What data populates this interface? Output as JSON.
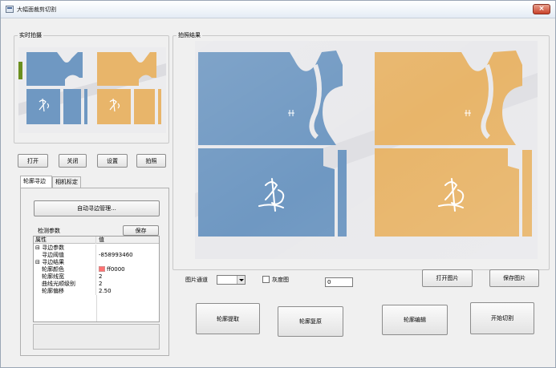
{
  "window": {
    "title": "大幅面裁剪切割",
    "close_glyph": "×"
  },
  "live_group": {
    "legend": "实时拍摄"
  },
  "buttons": {
    "open": "打开",
    "close": "关闭",
    "settings": "设置",
    "capture": "拍照"
  },
  "tabs": [
    {
      "label": "轮廓寻边"
    },
    {
      "label": "相机标定"
    }
  ],
  "auto_seek_button": "自动寻边管理...",
  "detect_params": {
    "label": "检测参数",
    "save": "保存"
  },
  "property_grid": {
    "header": {
      "name": "属性",
      "value": "值"
    },
    "rows": [
      {
        "type": "category",
        "expand": "⊟",
        "name": "寻边参数",
        "value": ""
      },
      {
        "type": "item",
        "name": "寻边阈值",
        "value": "-858993460"
      },
      {
        "type": "category",
        "expand": "⊟",
        "name": "寻边结果",
        "value": ""
      },
      {
        "type": "item",
        "name": "轮廓颜色",
        "value": "ff0000",
        "swatch": "#ff0000"
      },
      {
        "type": "item",
        "name": "轮廓线宽",
        "value": "2"
      },
      {
        "type": "item",
        "name": "曲线光顺级别",
        "value": "2"
      },
      {
        "type": "item",
        "name": "轮廓偏移",
        "value": "2.50"
      }
    ]
  },
  "result_group": {
    "legend": "拍照结果"
  },
  "controls": {
    "channel_label": "图片通道",
    "channel_value": "",
    "gray_label": "灰度图",
    "number_value": "0",
    "open_image": "打开图片",
    "save_image": "保存图片",
    "extract_contour": "轮廓提取",
    "restore_contour": "轮廓复原",
    "edit_contour": "轮廓编辑",
    "start_cut": "开始切割"
  },
  "colors": {
    "blue_fabric": "#6f98c2",
    "orange_fabric": "#e8b56a",
    "fabric_bg": "#e9e9ec"
  }
}
